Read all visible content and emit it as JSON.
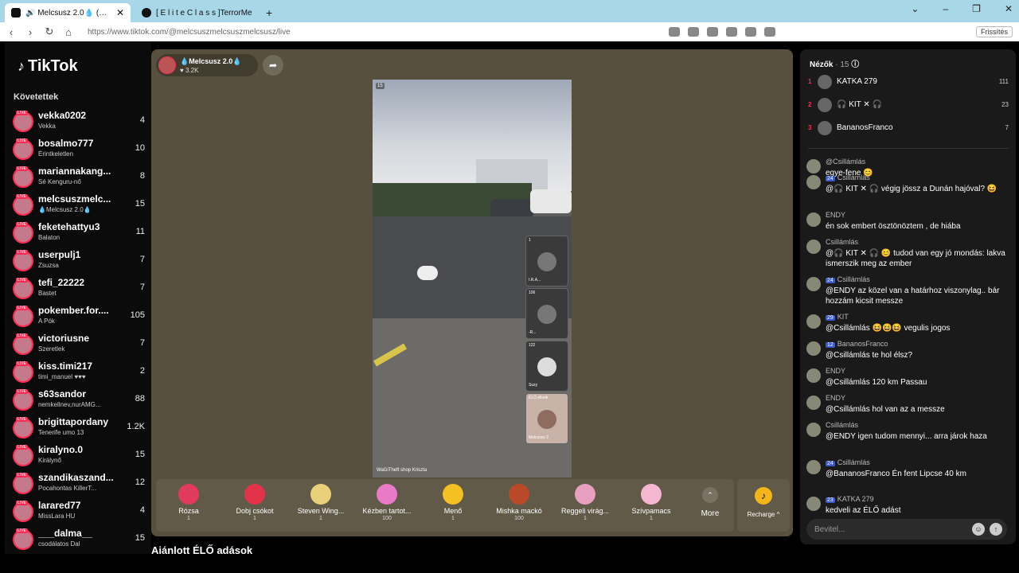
{
  "browser": {
    "tabs": [
      {
        "title": "🔊 Melcsusz 2.0💧 (@melc",
        "active": true
      },
      {
        "title": "[ E l i t e   C l a s s ]TerrorMe",
        "active": false
      }
    ],
    "new_tab": "+",
    "url": "https://www.tiktok.com/@melcsuszmelcsuszmelcsusz/live",
    "refresh_label": "Frissítés"
  },
  "nav": {
    "logo": "TikTok",
    "following_title": "Követettek",
    "following": [
      {
        "name": "vekka0202",
        "sub": "Vekka",
        "count": "4"
      },
      {
        "name": "bosalmo777",
        "sub": "Érintkeletlen",
        "count": "10"
      },
      {
        "name": "mariannakang...",
        "sub": "Sé Kenguru-nő",
        "count": "8"
      },
      {
        "name": "melcsuszmelc...",
        "sub": "💧Melcsusz 2.0💧",
        "count": "15"
      },
      {
        "name": "feketehattyu3",
        "sub": "Balaton",
        "count": "11"
      },
      {
        "name": "userpulj1",
        "sub": "Zsuzsa",
        "count": "7"
      },
      {
        "name": "tefi_22222",
        "sub": "Bastet",
        "count": "7"
      },
      {
        "name": "pokember.for....",
        "sub": "A Pók",
        "count": "105"
      },
      {
        "name": "victoriusne",
        "sub": "Szeretlek",
        "count": "7"
      },
      {
        "name": "kiss.timi217",
        "sub": "timi_manuel ♥♥♥",
        "count": "2"
      },
      {
        "name": "s63sandor",
        "sub": "nemkellnev,nurAMG...",
        "count": "88"
      },
      {
        "name": "brigittapordany",
        "sub": "Tenerife umo 13",
        "count": "1.2K"
      },
      {
        "name": "kiralyno.0",
        "sub": "Királynő",
        "count": "15"
      },
      {
        "name": "szandikaszand...",
        "sub": "Pocahontas KillerT...",
        "count": "12"
      },
      {
        "name": "larared77",
        "sub": "MissLara HU",
        "count": "4"
      },
      {
        "name": "___dalma__",
        "sub": "csodálatos Dal",
        "count": "15"
      }
    ]
  },
  "stream": {
    "host_name": "💧Melcsusz 2.0💧",
    "host_likes": "♥ 3.2K",
    "share_icon": "➦",
    "video_badge": "15",
    "video_caption": "WaGiTheft shop Kriszta",
    "guests": [
      {
        "count": "1",
        "name": "I.R.A..."
      },
      {
        "count": "106",
        "name": "-R..."
      },
      {
        "count": "122",
        "name": "Suzy"
      },
      {
        "count": "ÉLŐ élkelé",
        "name": "Melcsusz 2"
      }
    ]
  },
  "gifts": [
    {
      "name": "Rózsa",
      "price": "1",
      "color": "#e23a5a"
    },
    {
      "name": "Dobj csókot",
      "price": "1",
      "color": "#e2324a"
    },
    {
      "name": "Steven Wing...",
      "price": "1",
      "color": "#e9d07a"
    },
    {
      "name": "Kézben tartot...",
      "price": "100",
      "color": "#e87ac8"
    },
    {
      "name": "Menő",
      "price": "1",
      "color": "#f5c023"
    },
    {
      "name": "Mishka mackó",
      "price": "100",
      "color": "#b84a2a"
    },
    {
      "name": "Reggeli virág...",
      "price": "1",
      "color": "#e7a0c0"
    },
    {
      "name": "Szívpamacs",
      "price": "1",
      "color": "#f5b6d0"
    }
  ],
  "more_label": "More",
  "recharge_label": "Recharge ^",
  "recommended_title": "Ajánlott ÉLŐ adások",
  "viewers": {
    "title": "Nézők",
    "count": "· 15",
    "list": [
      {
        "rank": "1",
        "name": "KATKA 279",
        "count": "111"
      },
      {
        "rank": "2",
        "name": "🎧 KIT ✕ 🎧",
        "count": "23"
      },
      {
        "rank": "3",
        "name": "BananosFranco",
        "count": "7"
      }
    ]
  },
  "chat": [
    {
      "head": "@Csillámlás",
      "text": "egye-fene 😊",
      "lvl": ""
    },
    {
      "head": "Csillámlás",
      "text": "@🎧 KIT ✕ 🎧 végig jössz a Dunán hajóval? 😆",
      "lvl": "24"
    },
    {
      "head": "ENDY",
      "text": "én sok embert ösztönöztem , de hiába",
      "lvl": ""
    },
    {
      "head": "Csillámlás",
      "text": "@🎧 KIT ✕ 🎧 😊 tudod van egy jó mondás: lakva ismerszik meg az ember",
      "lvl": ""
    },
    {
      "head": "Csillámlás",
      "text": "@ENDY az közel van a határhoz viszonylag.. bár hozzám kicsit messze",
      "lvl": "24"
    },
    {
      "head": "KIT",
      "text": "@Csillámlás 😆😆😆 vegulis jogos",
      "lvl": "29"
    },
    {
      "head": "BananosFranco",
      "text": "@Csillámlás te hol élsz?",
      "lvl": "12"
    },
    {
      "head": "ENDY",
      "text": "@Csillámlás 120 km Passau",
      "lvl": ""
    },
    {
      "head": "ENDY",
      "text": "@Csillámlás hol van az a messze",
      "lvl": ""
    },
    {
      "head": "Csillámlás",
      "text": "@ENDY igen tudom mennyi... arra járok haza",
      "lvl": ""
    },
    {
      "head": "Csillámlás",
      "text": "@BananosFranco Én fent Lipcse 40 km",
      "lvl": "24"
    },
    {
      "head": "KATKA 279",
      "text": "kedveli az ÉLŐ adást",
      "lvl": "23"
    }
  ],
  "input_placeholder": "Bevitel...",
  "emoji_icon": "☺",
  "send_icon": "↑"
}
